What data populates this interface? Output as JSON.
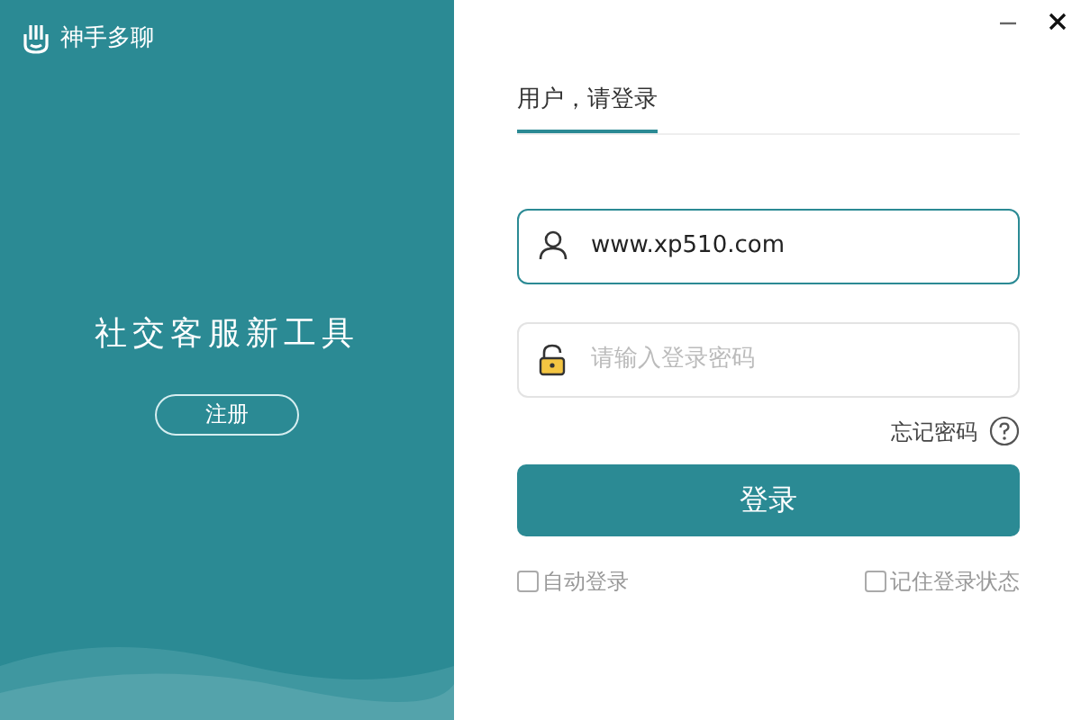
{
  "app": {
    "name": "神手多聊"
  },
  "tagline": "社交客服新工具",
  "register_button": "注册",
  "tabs": [
    {
      "label": "用户，请登录",
      "selected": true
    }
  ],
  "username": {
    "value": "www.xp510.com",
    "focused": true
  },
  "password": {
    "placeholder": "请输入登录密码",
    "focused": false
  },
  "forgot_password": "忘记密码",
  "login_button": "登录",
  "options": [
    {
      "label": "自动登录",
      "checked": false
    },
    {
      "label": "记住登录状态",
      "checked": false
    }
  ]
}
